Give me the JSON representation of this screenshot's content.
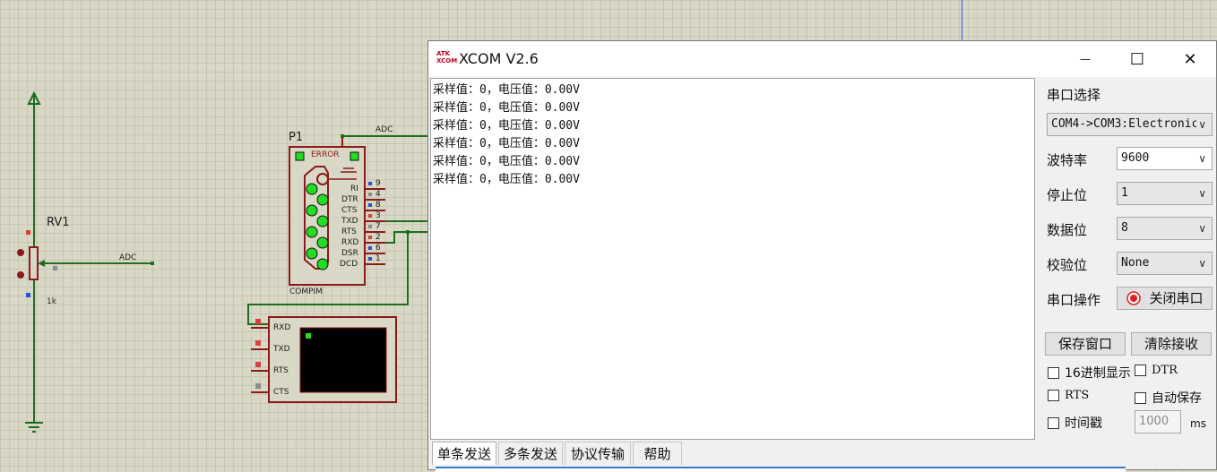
{
  "schematic": {
    "rv1_label": "RV1",
    "rv1_value": "1k",
    "adc_net_label_1": "ADC",
    "adc_net_label_2": "ADC",
    "p1_label": "P1",
    "p1_error": "ERROR",
    "p1_pins_left": [
      "RI",
      "DTR",
      "CTS",
      "TXD",
      "RTS",
      "RXD",
      "DSR",
      "DCD"
    ],
    "p1_pin_numbers": [
      "9",
      "4",
      "8",
      "3",
      "7",
      "2",
      "6",
      "1"
    ],
    "p1_part": "COMPIM",
    "terminal_pins": [
      "RXD",
      "TXD",
      "RTS",
      "CTS"
    ]
  },
  "window": {
    "logo": "ATK\nXCOM",
    "title": "XCOM V2.6",
    "minimize_glyph": "—",
    "maximize_glyph": "☐",
    "close_glyph": "✕"
  },
  "receive_lines": [
    "采样值：0，电压值：0.00V",
    "采样值：0，电压值：0.00V",
    "采样值：0，电压值：0.00V",
    "采样值：0，电压值：0.00V",
    "采样值：0，电压值：0.00V",
    "采样值：0，电压值：0.00V"
  ],
  "panel": {
    "port_select_label": "串口选择",
    "port_value": "COM4->COM3:Electronic",
    "baud_label": "波特率",
    "baud_value": "9600",
    "stopbit_label": "停止位",
    "stopbit_value": "1",
    "databit_label": "数据位",
    "databit_value": "8",
    "parity_label": "校验位",
    "parity_value": "None",
    "port_op_label": "串口操作",
    "close_port_button": "关闭串口",
    "save_window_button": "保存窗口",
    "clear_receive_button": "清除接收",
    "hex_display": "16进制显示",
    "dtr": "DTR",
    "rts": "RTS",
    "auto_save": "自动保存",
    "timestamp": "时间戳",
    "timestamp_value": "1000",
    "timestamp_unit": "ms"
  },
  "tabs": [
    "单条发送",
    "多条发送",
    "协议传输",
    "帮助"
  ],
  "colors": {
    "wire": "#1e6e1e",
    "component": "#8b1a1a",
    "led_green": "#22dd22",
    "terminal_screen": "#000000"
  }
}
